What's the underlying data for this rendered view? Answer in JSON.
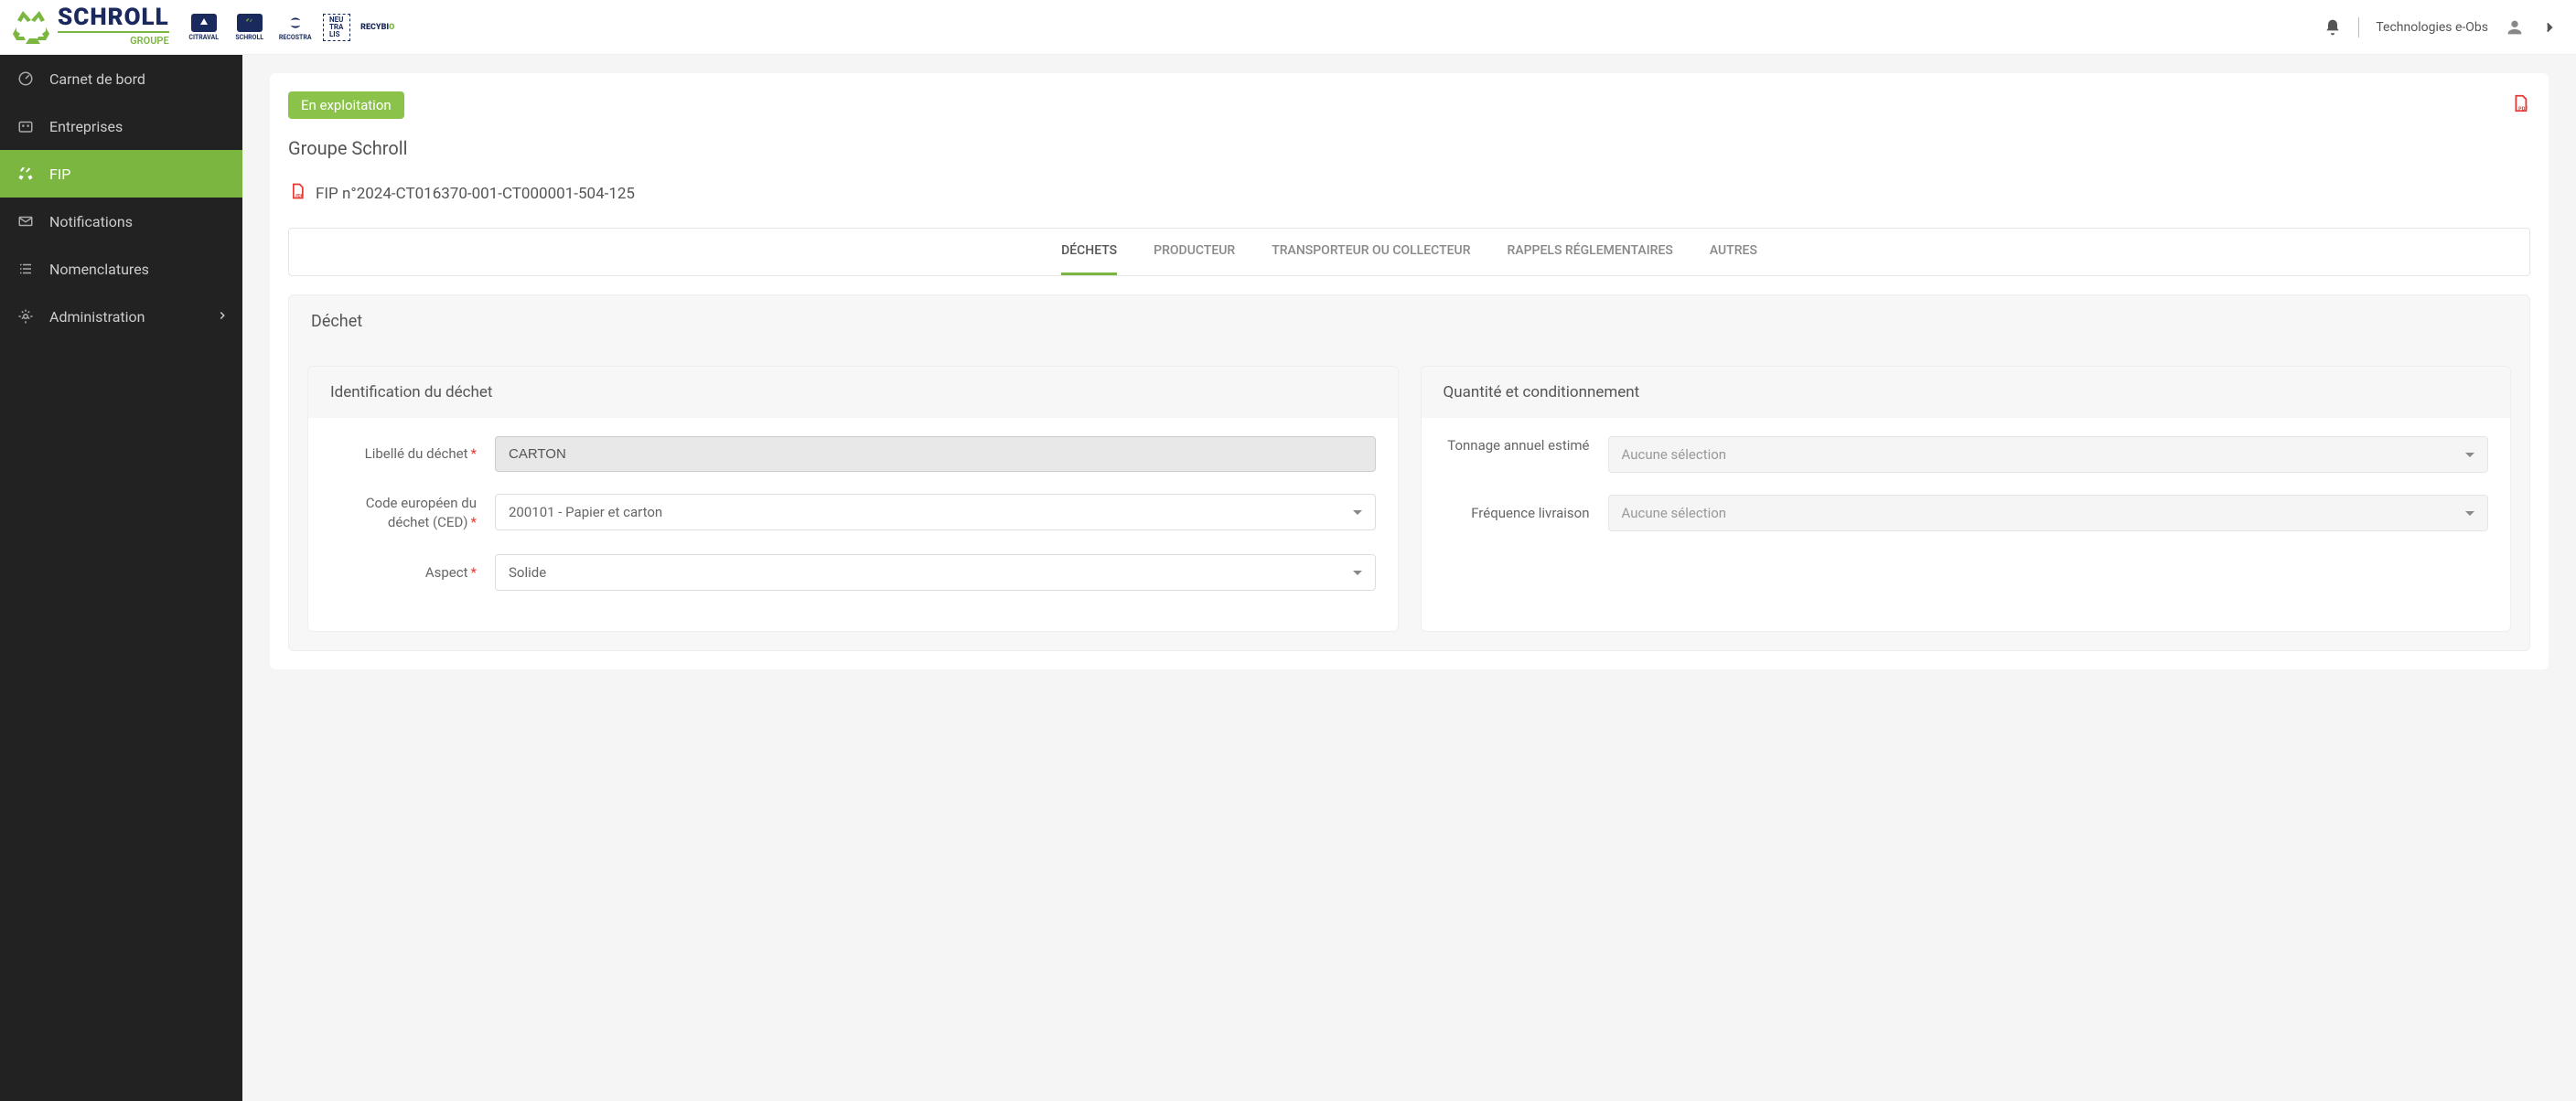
{
  "header": {
    "logo_text": "SCHROLL",
    "logo_sub": "GROUPE",
    "partner_logos": [
      {
        "name": "CITRAVAL"
      },
      {
        "name": "SCHROLL"
      },
      {
        "name": "RECOSTRA"
      },
      {
        "name": "NEU TRA LIS"
      },
      {
        "name": "RECYBIO"
      }
    ],
    "user_name": "Technologies e-Obs"
  },
  "sidebar": {
    "items": [
      {
        "label": "Carnet de bord",
        "icon": "dashboard-icon"
      },
      {
        "label": "Entreprises",
        "icon": "building-icon"
      },
      {
        "label": "FIP",
        "icon": "recycle-icon",
        "active": true
      },
      {
        "label": "Notifications",
        "icon": "mail-icon"
      },
      {
        "label": "Nomenclatures",
        "icon": "list-icon"
      },
      {
        "label": "Administration",
        "icon": "gear-icon",
        "expandable": true
      }
    ]
  },
  "main": {
    "status_badge": "En exploitation",
    "company_name": "Groupe Schroll",
    "fip_number": "FIP n°2024-CT016370-001-CT000001-504-125",
    "tabs": [
      {
        "label": "DÉCHETS",
        "active": true
      },
      {
        "label": "PRODUCTEUR"
      },
      {
        "label": "TRANSPORTEUR OU COLLECTEUR"
      },
      {
        "label": "RAPPELS RÉGLEMENTAIRES"
      },
      {
        "label": "AUTRES"
      }
    ],
    "section_title": "Déchet",
    "left_panel": {
      "title": "Identification du déchet",
      "fields": {
        "libelle": {
          "label": "Libellé du déchet",
          "value": "CARTON",
          "required": true
        },
        "ced": {
          "label": "Code européen du déchet (CED)",
          "value": "200101 - Papier et carton",
          "required": true
        },
        "aspect": {
          "label": "Aspect",
          "value": "Solide",
          "required": true
        }
      }
    },
    "right_panel": {
      "title": "Quantité et conditionnement",
      "fields": {
        "tonnage": {
          "label": "Tonnage annuel estimé",
          "placeholder": "Aucune sélection"
        },
        "frequence": {
          "label": "Fréquence livraison",
          "placeholder": "Aucune sélection"
        }
      }
    }
  }
}
